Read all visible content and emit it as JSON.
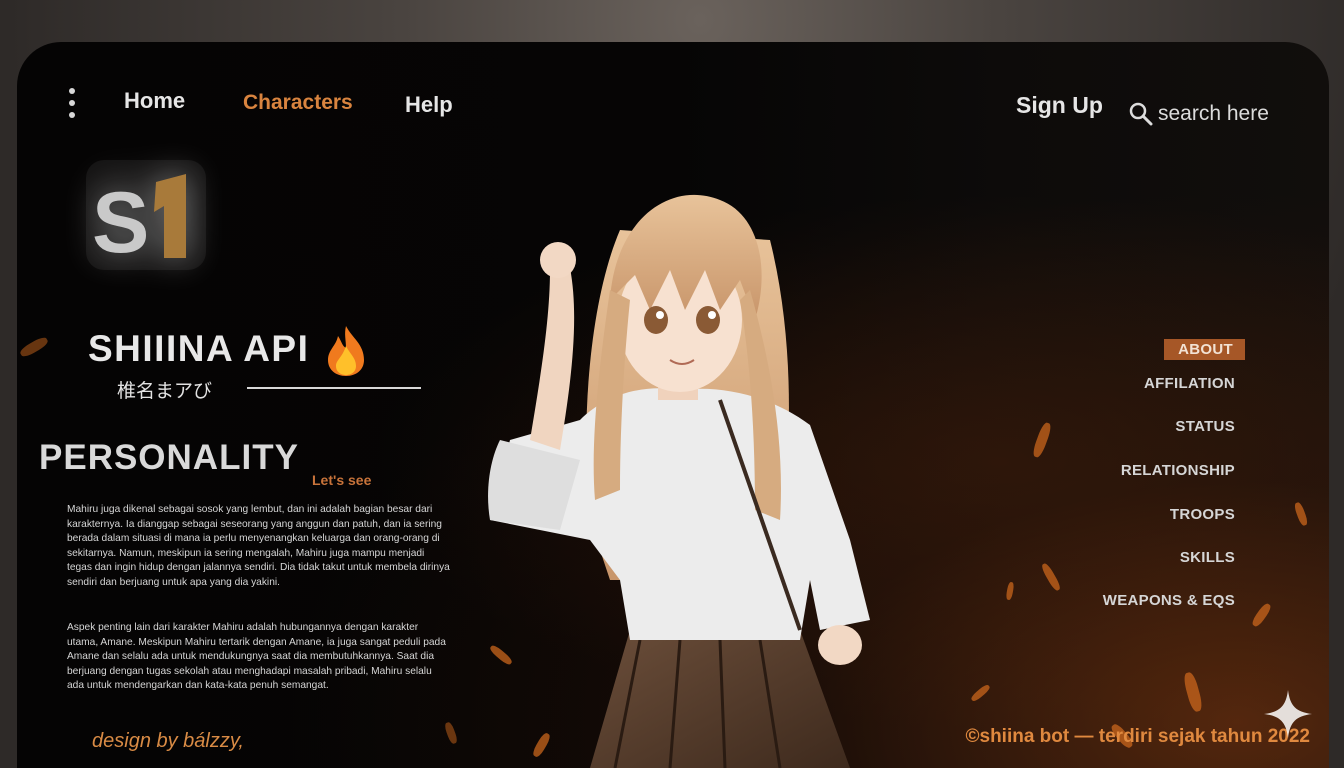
{
  "nav": {
    "home": "Home",
    "characters": "Characters",
    "help": "Help",
    "sign_up": "Sign Up",
    "search_placeholder": "search here"
  },
  "brand": {
    "logo_text": "S1",
    "title": "SHIIINA API",
    "subtitle": "椎名まアび"
  },
  "personality": {
    "heading": "PERSONALITY",
    "tag": "Let's see",
    "paragraphs": [
      "Mahiru juga dikenal sebagai sosok yang lembut, dan ini adalah bagian besar dari karakternya. Ia dianggap sebagai seseorang yang anggun dan patuh, dan ia sering berada dalam situasi di mana ia perlu menyenangkan keluarga dan orang-orang di sekitarnya. Namun, meskipun ia sering mengalah, Mahiru juga mampu menjadi tegas dan ingin hidup dengan jalannya sendiri. Dia tidak takut untuk membela dirinya sendiri dan berjuang untuk apa yang dia yakini.",
      "Aspek penting lain dari karakter Mahiru adalah hubungannya dengan karakter utama, Amane. Meskipun Mahiru tertarik dengan Amane, ia juga sangat peduli pada Amane dan selalu ada untuk mendukungnya saat dia membutuhkannya. Saat dia berjuang dengan tugas sekolah atau menghadapi masalah pribadi, Mahiru selalu ada untuk mendengarkan dan kata-kata penuh semangat."
    ]
  },
  "side_menu": {
    "about": "ABOUT",
    "affilation": "AFFILATION",
    "status": "STATUS",
    "relationship": "RELATIONSHIP",
    "troops": "TROOPS",
    "skills": "SKILLS",
    "weapons": "WEAPONS & EQS"
  },
  "footer": {
    "credit": "design by bálzzy,",
    "copyright": "©shiina bot — terdiri sejak tahun 2022"
  },
  "icons": {
    "menu": "vertical-dots-icon",
    "search": "magnifier-icon",
    "flame": "fire-emoji-icon",
    "sparkle": "four-point-star-icon"
  },
  "colors": {
    "accent": "#d9843f",
    "active_menu_bg": "#a65727",
    "panel_bg": "#050404",
    "text": "#e6e6e6"
  }
}
